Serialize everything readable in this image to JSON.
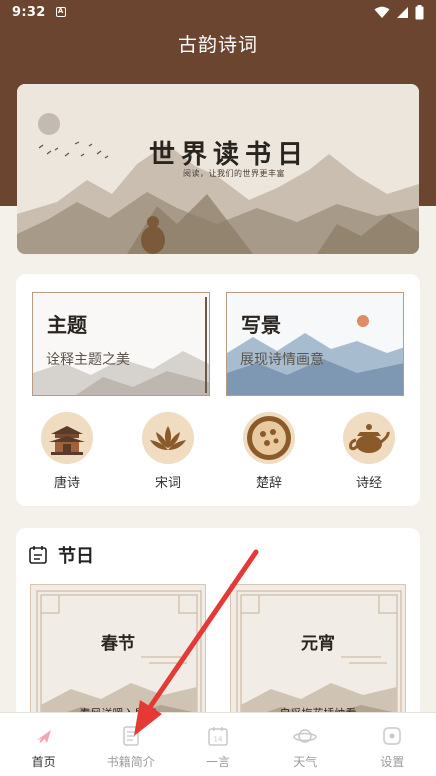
{
  "status": {
    "time": "9:32",
    "notif_badge": "A"
  },
  "app": {
    "title": "古韵诗词"
  },
  "banner": {
    "title": "世界读书日",
    "subtitle": "阅读，让我们的世界更丰富"
  },
  "themes": [
    {
      "title": "主题",
      "subtitle": "诠释主题之美"
    },
    {
      "title": "写景",
      "subtitle": "展现诗情画意"
    }
  ],
  "categories": [
    {
      "label": "唐诗",
      "icon": "pavilion-icon"
    },
    {
      "label": "宋词",
      "icon": "lotus-icon"
    },
    {
      "label": "楚辞",
      "icon": "plate-icon"
    },
    {
      "label": "诗经",
      "icon": "teapot-icon"
    }
  ],
  "festival_section": {
    "title": "节日",
    "icon": "calendar-icon"
  },
  "festivals": [
    {
      "title": "春节",
      "subtitle": "春风送暖入屠苏"
    },
    {
      "title": "元宵",
      "subtitle": "自妥梅花插烛看"
    }
  ],
  "nav": [
    {
      "label": "首页",
      "icon": "home-icon"
    },
    {
      "label": "书籍简介",
      "icon": "book-icon"
    },
    {
      "label": "一言",
      "icon": "calendar-14-icon",
      "icon_text": "14"
    },
    {
      "label": "天气",
      "icon": "planet-icon"
    },
    {
      "label": "设置",
      "icon": "settings-icon"
    }
  ],
  "colors": {
    "brand": "#6b4530",
    "background": "#f4f1eb",
    "accent": "#efdcc1",
    "annotation": "#e53935"
  }
}
